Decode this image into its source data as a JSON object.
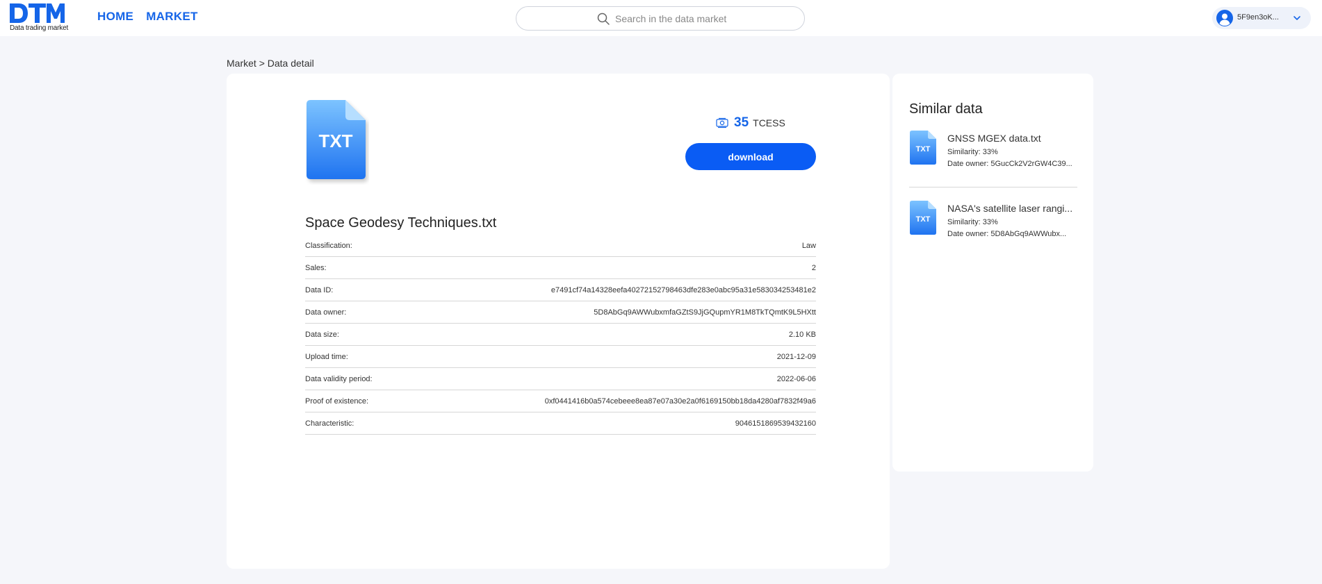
{
  "header": {
    "logo_text": "DTM",
    "logo_subtitle": "Data trading market",
    "nav": [
      {
        "label": "HOME"
      },
      {
        "label": "MARKET"
      }
    ],
    "search_placeholder": "Search in the data market",
    "user": {
      "name": "5F9en3oK...",
      "avatar_icon": "user-avatar-icon",
      "chevron_icon": "chevron-down-icon"
    }
  },
  "breadcrumb": {
    "market": "Market",
    "separator": ">",
    "current": "Data detail"
  },
  "file": {
    "type_label": "TXT",
    "title": "Space Geodesy Techniques.txt",
    "price": {
      "value": "35",
      "unit": "TCESS",
      "icon": "coin-icon"
    },
    "download_label": "download",
    "details": [
      {
        "label": "Classification:",
        "value": "Law"
      },
      {
        "label": "Sales:",
        "value": "2"
      },
      {
        "label": "Data ID:",
        "value": "e7491cf74a14328eefa40272152798463dfe283e0abc95a31e583034253481e2"
      },
      {
        "label": "Data owner:",
        "value": "5D8AbGq9AWWubxmfaGZtS9JjGQupmYR1M8TkTQmtK9L5HXtt"
      },
      {
        "label": "Data size:",
        "value": "2.10 KB"
      },
      {
        "label": "Upload time:",
        "value": "2021-12-09"
      },
      {
        "label": "Data validity period:",
        "value": "2022-06-06"
      },
      {
        "label": "Proof of existence:",
        "value": "0xf0441416b0a574cebeee8ea87e07a30e2a0f6169150bb18da4280af7832f49a6"
      },
      {
        "label": "Characteristic:",
        "value": "9046151869539432160"
      }
    ]
  },
  "similar": {
    "title": "Similar data",
    "items": [
      {
        "type_label": "TXT",
        "name": "GNSS MGEX data.txt",
        "similarity": "Similarity: 33%",
        "owner": "Date owner: 5GucCk2V2rGW4C39..."
      },
      {
        "type_label": "TXT",
        "name": "NASA's satellite laser rangi...",
        "similarity": "Similarity: 33%",
        "owner": "Date owner: 5D8AbGq9AWWubx..."
      }
    ]
  },
  "colors": {
    "accent": "#1565e8",
    "button": "#0a5cf4",
    "background": "#f5f6fa"
  }
}
